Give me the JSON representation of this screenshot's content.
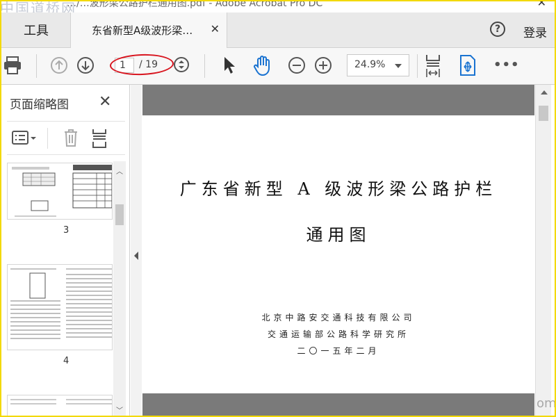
{
  "window": {
    "title": "…/…波形梁公路护栏通用图.pdf - Adobe Acrobat Pro DC",
    "watermark": "中国道桥网",
    "corner_watermark": "om"
  },
  "tabs": {
    "tools_label": "工具",
    "doc_tab_label": "东省新型A级波形梁…",
    "login_label": "登录"
  },
  "toolbar": {
    "current_page": "1",
    "total_pages": "/ 19",
    "zoom": "24.9%"
  },
  "sidebar": {
    "title": "页面缩略图",
    "thumbnails": [
      {
        "label": "3"
      },
      {
        "label": "4"
      }
    ]
  },
  "document": {
    "title": "广东省新型 A 级波形梁公路护栏",
    "subtitle": "通用图",
    "org1": "北京中路安交通科技有限公司",
    "org2": "交通运输部公路科学研究所",
    "date": "二〇一五年二月"
  },
  "icons": {
    "print": "print-icon",
    "prev_page": "arrow-up-circle-icon",
    "next_page": "arrow-down-circle-icon",
    "page_nav": "page-nav-icon",
    "select": "cursor-arrow-icon",
    "hand": "hand-tool-icon",
    "zoom_out": "zoom-out-icon",
    "zoom_in": "zoom-in-icon",
    "fit_width": "fit-width-icon",
    "scroll_mode": "scroll-mode-icon",
    "more": "more-icon"
  }
}
